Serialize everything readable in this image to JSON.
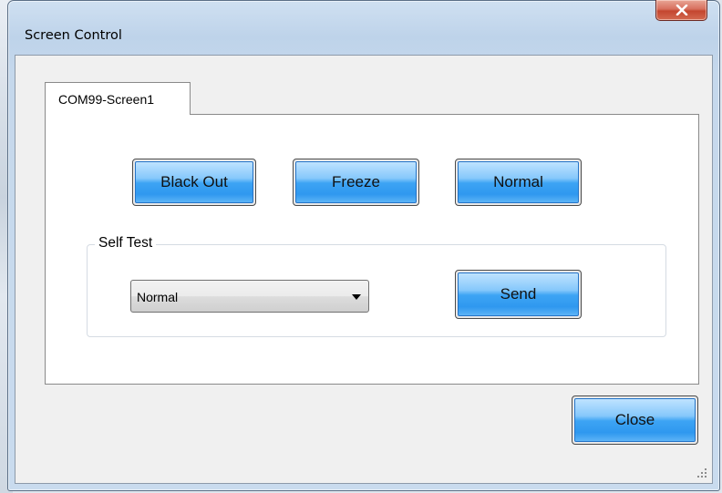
{
  "window": {
    "title": "Screen Control"
  },
  "tabs": [
    {
      "label": "COM99-Screen1"
    }
  ],
  "actions": {
    "black_out_label": "Black Out",
    "freeze_label": "Freeze",
    "normal_label": "Normal"
  },
  "self_test": {
    "group_label": "Self Test",
    "selected_mode": "Normal",
    "send_label": "Send"
  },
  "footer": {
    "close_label": "Close"
  },
  "icons": {
    "title_close": "close-icon",
    "combo_arrow": "dropdown-arrow-icon",
    "resize_grip": "resize-grip-icon"
  },
  "colors": {
    "button_accent": "#2f98ef",
    "title_close_red": "#c4462f"
  }
}
